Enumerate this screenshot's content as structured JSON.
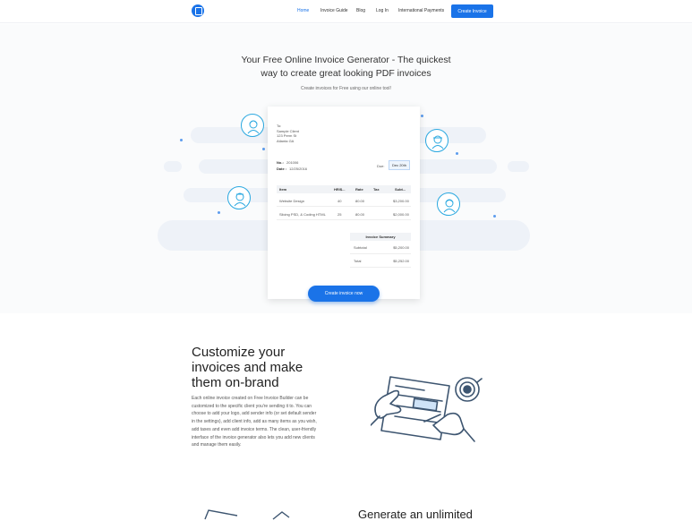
{
  "nav": {
    "links": [
      "Home",
      "Invoice Guide",
      "Blog",
      "Log In",
      "International Payments"
    ],
    "cta": "Create Invoice"
  },
  "hero": {
    "title_line1": "Your Free Online Invoice Generator - The quickest",
    "title_line2": "way to create great looking PDF invoices",
    "subtitle": "Create invoices for Free using our online tool!"
  },
  "invoice": {
    "to_label": "To:",
    "client_name": "Sample Client",
    "client_street": "123 Perm St",
    "client_city": "Atlanta GA",
    "no_label": "No.:",
    "no_value": "201006",
    "date_label": "Date :",
    "date_value": "12/25/2016",
    "due_label": "Due:",
    "due_value": "Dec 20th",
    "columns": [
      "Item",
      "HR/$...",
      "Rate",
      "Tax",
      "Subt..."
    ],
    "rows": [
      {
        "item": "Website Design",
        "hrs": "40",
        "rate": "80.00",
        "tax": "",
        "subtotal": "$3,200.00"
      },
      {
        "item": "Slicing PSD, & Coding HTML",
        "hrs": "25",
        "rate": "80.00",
        "tax": "",
        "subtotal": "$2,000.00"
      }
    ],
    "summary_title": "Invoice Summary",
    "subtotal_label": "Subtotal",
    "subtotal_value": "$5,200.00",
    "total_label": "Total",
    "total_value": "$5,252.00"
  },
  "hero_cta": "Create invoice now",
  "feature": {
    "title": "Customize your invoices and make them on-brand",
    "body": "Each online invoice created on Free Invoice Builder can be customized to the specific client you're sending it to. You can choose to add your logo, add sender info (or set default sender in the settings), add client info, add as many items as you wish, add taxes and even add invoice terms. The clean, user-friendly interface of the invoice generator also lets you add new clients and manage them easily."
  },
  "next_section_title": "Generate an unlimited",
  "colors": {
    "accent": "#1a73e8",
    "avatar_stroke": "#2aa8e0",
    "illustration": "#3d5570"
  }
}
